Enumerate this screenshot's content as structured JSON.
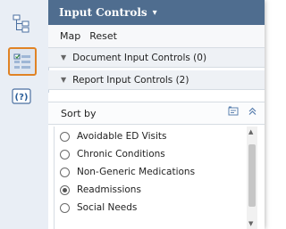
{
  "panel": {
    "title": "Input Controls",
    "title_caret": "▾",
    "menu": [
      "Map",
      "Reset"
    ],
    "document_section": "Document Input Controls (0)",
    "report_section": "Report Input Controls (2)",
    "sort_label": "Sort by",
    "options": [
      {
        "label": "Avoidable ED Visits",
        "selected": false
      },
      {
        "label": "Chronic Conditions",
        "selected": false
      },
      {
        "label": "Non-Generic Medications",
        "selected": false
      },
      {
        "label": "Readmissions",
        "selected": true
      },
      {
        "label": "Social Needs",
        "selected": false
      }
    ]
  },
  "rail": {
    "icons": [
      "navigation-map-icon",
      "input-controls-icon",
      "help-icon"
    ],
    "active_highlight_color": "#e08325"
  },
  "colors": {
    "header_bg": "#4f6d8f",
    "rail_bg": "#e9eef5"
  }
}
